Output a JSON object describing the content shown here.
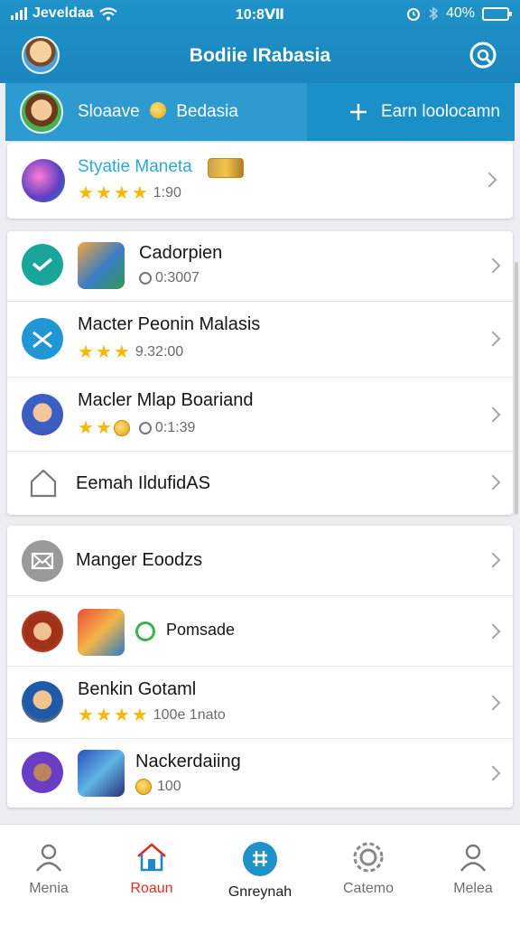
{
  "status_bar": {
    "carrier": "Jeveldaa",
    "time": "10:8Ⅶ",
    "battery": "40%"
  },
  "header": {
    "title": "Bodiie IRabasia"
  },
  "subbar": {
    "name": "Sloaave",
    "location": "Bedasia",
    "action": "Earn loolocamn"
  },
  "card1": {
    "rows": [
      {
        "title": "Styatie Maneta",
        "rating": "1:90",
        "stars": 4
      }
    ]
  },
  "card2": {
    "rows": [
      {
        "title": "Cadorpien",
        "meta": "0:3007"
      },
      {
        "title": "Macter Peonin Malasis",
        "meta": "9.32:00",
        "stars": 3
      },
      {
        "title": "Macler Mlap Boariand",
        "meta": "0:1:39",
        "stars": 3
      },
      {
        "title": "Eemah IldufidAS"
      }
    ]
  },
  "card3": {
    "rows": [
      {
        "title": "Manger Eoodzs"
      },
      {
        "title": "Pomsade"
      },
      {
        "title": "Benkin Gotaml",
        "meta": "100e 1nato",
        "stars": 4
      },
      {
        "title": "Nackerdaiing",
        "meta": "100"
      }
    ]
  },
  "tabs": [
    {
      "label": "Menia"
    },
    {
      "label": "Roaun"
    },
    {
      "label": "Gnreynah"
    },
    {
      "label": "Catemo"
    },
    {
      "label": "Melea"
    }
  ],
  "colors": {
    "primary": "#1b8fc7",
    "active_red": "#d93025",
    "teal": "#1aa59a",
    "star": "#f5b80b"
  }
}
